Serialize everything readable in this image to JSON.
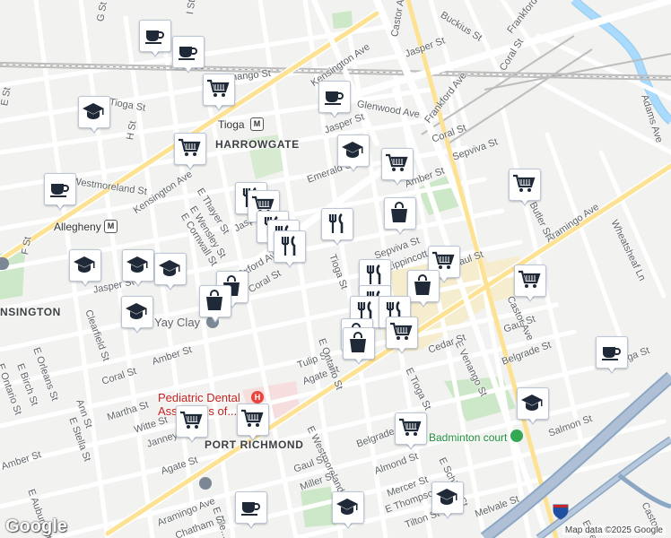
{
  "map": {
    "attribution": "Map data ©2025 Google",
    "logo": "Google",
    "neighborhoods": [
      {
        "text": "HARROWGATE"
      },
      {
        "text": "PORT RICHMOND"
      },
      {
        "text": "NSINGTON"
      }
    ],
    "stations": [
      {
        "text": "Tioga"
      },
      {
        "text": "Allegheny"
      }
    ],
    "pois": [
      {
        "text": "Pediatric Dental",
        "color": "#c5221f"
      },
      {
        "text": "Associates of...",
        "color": "#c5221f"
      },
      {
        "text": "Badminton court",
        "color": "#1e8e3e"
      },
      {
        "text": "Yay Clay",
        "color": "#5f6368"
      }
    ],
    "streets": [
      {
        "text": "G St"
      },
      {
        "text": "I St"
      },
      {
        "text": "E Venango St"
      },
      {
        "text": "E Tioga St"
      },
      {
        "text": "H St"
      },
      {
        "text": "E St"
      },
      {
        "text": "E Westmoreland St"
      },
      {
        "text": "Kensington Ave"
      },
      {
        "text": "E Thayer St"
      },
      {
        "text": "E Wensley St"
      },
      {
        "text": "E Cornwall St"
      },
      {
        "text": "Allegheny"
      },
      {
        "text": "F St"
      },
      {
        "text": "Jasper St"
      },
      {
        "text": "Clearfield St"
      },
      {
        "text": "E Orleans St"
      },
      {
        "text": "E Birch St"
      },
      {
        "text": "E Ontario St"
      },
      {
        "text": "Amber St"
      },
      {
        "text": "Coral St"
      },
      {
        "text": "Martha St"
      },
      {
        "text": "Witte St"
      },
      {
        "text": "Janney St"
      },
      {
        "text": "Ann St"
      },
      {
        "text": "E Stella St"
      },
      {
        "text": "Agate St"
      },
      {
        "text": "E Auburn St"
      },
      {
        "text": "Amber St"
      },
      {
        "text": "Aramingo Ave"
      },
      {
        "text": "Tulip St"
      },
      {
        "text": "Agate St"
      },
      {
        "text": "E Ontario St"
      },
      {
        "text": "E Westmoreland St"
      },
      {
        "text": "Gaul St"
      },
      {
        "text": "Miller St"
      },
      {
        "text": "Belgrade St"
      },
      {
        "text": "Almond St"
      },
      {
        "text": "Mercer St"
      },
      {
        "text": "E Thompson St"
      },
      {
        "text": "E Schiller St"
      },
      {
        "text": "Tilton St"
      },
      {
        "text": "Melvale St"
      },
      {
        "text": "Salmon St"
      },
      {
        "text": "E Tioga St"
      },
      {
        "text": "E Venango St"
      },
      {
        "text": "Cedar St"
      },
      {
        "text": "Gaul St"
      },
      {
        "text": "Belgrade St"
      },
      {
        "text": "E Tioga St"
      },
      {
        "text": "Castor Ave"
      },
      {
        "text": "Aramingo Ave"
      },
      {
        "text": "Wheatsheaf Ln"
      },
      {
        "text": "Butler St"
      },
      {
        "text": "Sepviva St"
      },
      {
        "text": "Amber St"
      },
      {
        "text": "Coral St"
      },
      {
        "text": "Emerald St"
      },
      {
        "text": "Jasper St"
      },
      {
        "text": "Glenwood Ave"
      },
      {
        "text": "Frankford Ave"
      },
      {
        "text": "Castor Ave"
      },
      {
        "text": "Kensington Ave"
      },
      {
        "text": "Jasper St"
      },
      {
        "text": "Buckius St"
      },
      {
        "text": "Coral St"
      },
      {
        "text": "Frankford Ave"
      },
      {
        "text": "Adams Ave"
      },
      {
        "text": "Oxford Ave"
      },
      {
        "text": "Coral St"
      },
      {
        "text": "Tioga St"
      },
      {
        "text": "Sepviva St"
      },
      {
        "text": "Lippincott St"
      },
      {
        "text": "Gaul St"
      },
      {
        "text": "E Cle..."
      },
      {
        "text": "Chatham St"
      },
      {
        "text": "Tilton St"
      },
      {
        "text": "E Ve..."
      },
      {
        "text": "Castor"
      },
      {
        "text": "Melvale St"
      },
      {
        "text": "Jasper"
      }
    ],
    "highway_shield": "95"
  }
}
